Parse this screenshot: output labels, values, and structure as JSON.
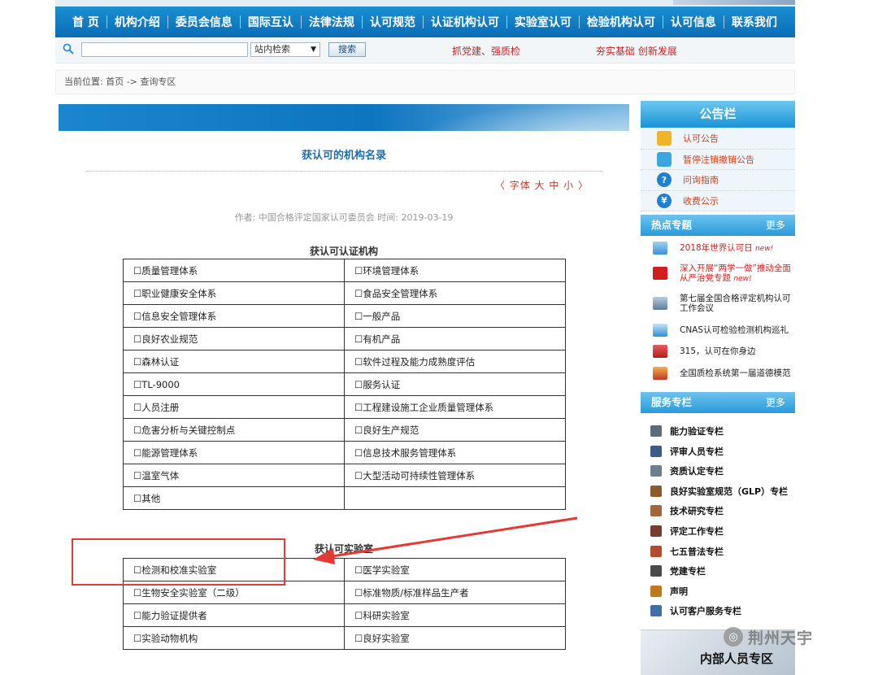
{
  "nav": {
    "items": [
      "首  页",
      "机构介绍",
      "委员会信息",
      "国际互认",
      "法律法规",
      "认可规范",
      "认证机构认可",
      "实验室认可",
      "检验机构认可",
      "认可信息",
      "联系我们"
    ]
  },
  "search": {
    "placeholder": "",
    "scope": "站内检索",
    "button": "搜索",
    "slogan_left": "抓党建、强质检",
    "slogan_right": "夯实基础 创新发展"
  },
  "breadcrumb": "当前位置: 首页 -> 查询专区",
  "article": {
    "title": "获认可的机构名录",
    "font_size_control": "〈 字体 大 中 小 〉",
    "meta": "作者: 中国合格评定国家认可委员会   时间: 2019-03-19",
    "section1_title": "获认可认证机构",
    "section1_rows": [
      [
        "☐质量管理体系",
        "☐环境管理体系"
      ],
      [
        "☐职业健康安全体系",
        "☐食品安全管理体系"
      ],
      [
        "☐信息安全管理体系",
        "☐一般产品"
      ],
      [
        "☐良好农业规范",
        "☐有机产品"
      ],
      [
        "☐森林认证",
        "☐软件过程及能力成熟度评估"
      ],
      [
        "☐TL-9000",
        "☐服务认证"
      ],
      [
        "☐人员注册",
        "☐工程建设施工企业质量管理体系"
      ],
      [
        "☐危害分析与关键控制点",
        "☐良好生产规范"
      ],
      [
        "☐能源管理体系",
        "☐信息技术服务管理体系"
      ],
      [
        "☐温室气体",
        "☐大型活动可持续性管理体系"
      ],
      [
        "☐其他",
        ""
      ]
    ],
    "section2_title": "获认可实验室",
    "section2_rows": [
      [
        "☐检测和校准实验室",
        "☐医学实验室"
      ],
      [
        "☐生物安全实验室（二级）",
        "☐标准物质/标准样品生产者"
      ],
      [
        "☐能力验证提供者",
        "☐科研实验室"
      ],
      [
        "☐实验动物机构",
        "☐良好实验室"
      ]
    ]
  },
  "sidebar": {
    "notice_title": "公告栏",
    "notices": [
      "认可公告",
      "暂停注销撤销公告",
      "问询指南",
      "收费公示"
    ],
    "hot_title": "热点专题",
    "more": "更多",
    "hot_items": [
      {
        "text": "2018年世界认可日",
        "badge": "new!"
      },
      {
        "text": "深入开展“两学一做”推动全面从严治党专题",
        "badge": "new!"
      },
      {
        "text": "第七届全国合格评定机构认可工作会议",
        "badge": ""
      },
      {
        "text": "CNAS认可检验检测机构巡礼",
        "badge": ""
      },
      {
        "text": "315，认可在你身边",
        "badge": ""
      },
      {
        "text": "全国质检系统第一届道德模范",
        "badge": ""
      }
    ],
    "service_title": "服务专栏",
    "services": [
      "能力验证专栏",
      "评审人员专栏",
      "资质认定专栏",
      "良好实验室规范（GLP）专栏",
      "技术研究专栏",
      "评定工作专栏",
      "七五普法专栏",
      "党建专栏",
      "声明",
      "认可客户服务专栏"
    ],
    "internal_zone": "内部人员专区"
  },
  "watermark": "荆州天宇",
  "colors": {
    "nav_blue": "#0a6cb5",
    "title_blue": "#1a6eb5",
    "slogan_red": "#d11e1e",
    "annotation_red": "#e53935"
  }
}
